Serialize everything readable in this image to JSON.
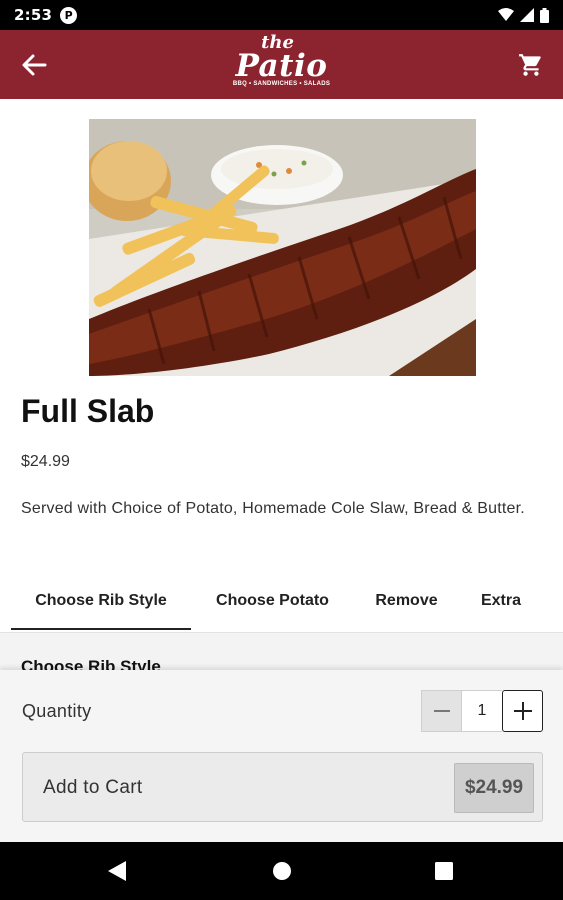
{
  "status_bar": {
    "time": "2:53",
    "app_icon_letter": "P"
  },
  "header": {
    "logo_small": "the",
    "logo_big": "Patio",
    "logo_tagline": "BBQ • SANDWICHES • SALADS",
    "brand_color": "#8c2430"
  },
  "item": {
    "title": "Full Slab",
    "price": "$24.99",
    "description": "Served with Choice of Potato, Homemade Cole Slaw, Bread & Butter."
  },
  "tabs": [
    {
      "label": "Choose Rib Style",
      "active": true
    },
    {
      "label": "Choose Potato",
      "active": false
    },
    {
      "label": "Remove",
      "active": false
    },
    {
      "label": "Extra",
      "active": false
    }
  ],
  "options": {
    "heading": "Choose Rib Style"
  },
  "cart_panel": {
    "quantity_label": "Quantity",
    "quantity": "1",
    "add_label": "Add to Cart",
    "add_price": "$24.99"
  },
  "icons": {
    "back": "arrow-back-icon",
    "cart": "cart-icon",
    "nav_back": "nav-back-icon",
    "nav_home": "nav-home-icon",
    "nav_recents": "nav-recents-icon"
  }
}
